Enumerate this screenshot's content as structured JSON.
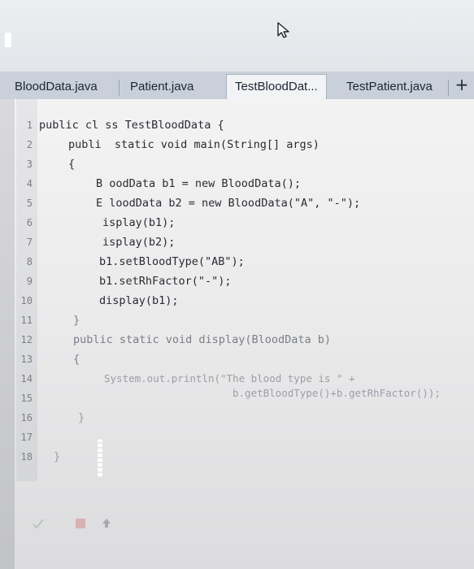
{
  "tabs": [
    {
      "label": "BloodData.java"
    },
    {
      "label": "Patient.java"
    },
    {
      "label": "TestBloodDat..."
    },
    {
      "label": "TestPatient.java"
    }
  ],
  "add_tab_label": "+",
  "line_numbers": [
    "1",
    "2",
    "3",
    "4",
    "5",
    "6",
    "7",
    "8",
    "9",
    "10",
    "11",
    "12",
    "13",
    "14",
    "15",
    "16",
    "17",
    "18"
  ],
  "code_lines": [
    "public cl ss TestBloodData {",
    "publi  static void main(String[] args)",
    "{",
    "B oodData b1 = new BloodData();",
    "E loodData b2 = new BloodData(\"A\", \"-\");",
    "isplay(b1);",
    "isplay(b2);",
    "b1.setBloodType(\"AB\");",
    "b1.setRhFactor(\"-\");",
    "display(b1);",
    "}",
    "public static void display(BloodData b)",
    "{",
    "System.out.println(\"The blood type is \" +",
    "b.getBloodType()+b.getRhFactor());",
    "}",
    "}"
  ]
}
